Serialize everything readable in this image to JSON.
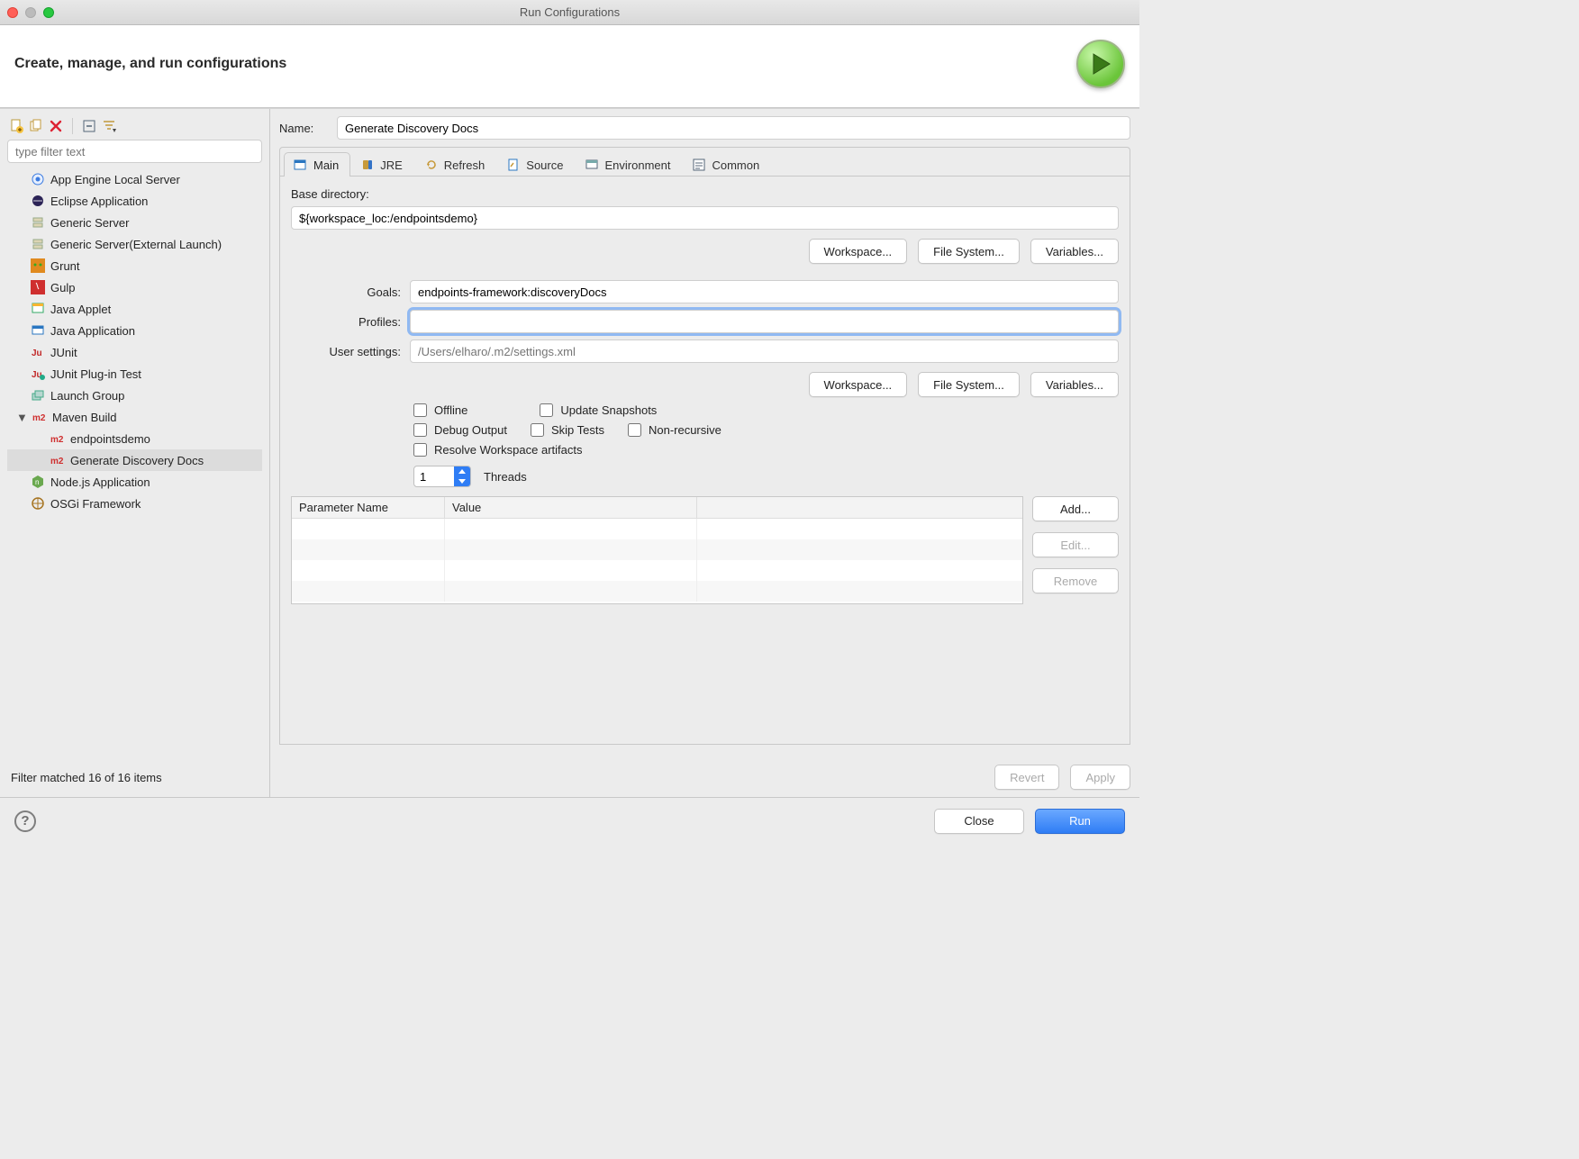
{
  "window": {
    "title": "Run Configurations"
  },
  "header": {
    "title": "Create, manage, and run configurations"
  },
  "filter": {
    "placeholder": "type filter text"
  },
  "tree": {
    "items": [
      {
        "label": "App Engine Local Server"
      },
      {
        "label": "Eclipse Application"
      },
      {
        "label": "Generic Server"
      },
      {
        "label": "Generic Server(External Launch)"
      },
      {
        "label": "Grunt"
      },
      {
        "label": "Gulp"
      },
      {
        "label": "Java Applet"
      },
      {
        "label": "Java Application"
      },
      {
        "label": "JUnit"
      },
      {
        "label": "JUnit Plug-in Test"
      },
      {
        "label": "Launch Group"
      },
      {
        "label": "Maven Build",
        "expanded": true,
        "children": [
          {
            "label": "endpointsdemo"
          },
          {
            "label": "Generate Discovery Docs",
            "selected": true
          }
        ]
      },
      {
        "label": "Node.js Application"
      },
      {
        "label": "OSGi Framework"
      }
    ]
  },
  "filter_status": "Filter matched 16 of 16 items",
  "form": {
    "name_label": "Name:",
    "name_value": "Generate Discovery Docs",
    "tabs": [
      "Main",
      "JRE",
      "Refresh",
      "Source",
      "Environment",
      "Common"
    ],
    "base_dir_label": "Base directory:",
    "base_dir_value": "${workspace_loc:/endpointsdemo}",
    "btn_workspace": "Workspace...",
    "btn_filesystem": "File System...",
    "btn_variables": "Variables...",
    "goals_label": "Goals:",
    "goals_value": "endpoints-framework:discoveryDocs",
    "profiles_label": "Profiles:",
    "profiles_value": "",
    "usersettings_label": "User settings:",
    "usersettings_placeholder": "/Users/elharo/.m2/settings.xml",
    "cb_offline": "Offline",
    "cb_update": "Update Snapshots",
    "cb_debug": "Debug Output",
    "cb_skip": "Skip Tests",
    "cb_nonrec": "Non-recursive",
    "cb_resolve": "Resolve Workspace artifacts",
    "threads_value": "1",
    "threads_label": "Threads",
    "param_col1": "Parameter Name",
    "param_col2": "Value",
    "btn_add": "Add...",
    "btn_edit": "Edit...",
    "btn_remove": "Remove",
    "btn_revert": "Revert",
    "btn_apply": "Apply"
  },
  "footer": {
    "btn_close": "Close",
    "btn_run": "Run"
  }
}
